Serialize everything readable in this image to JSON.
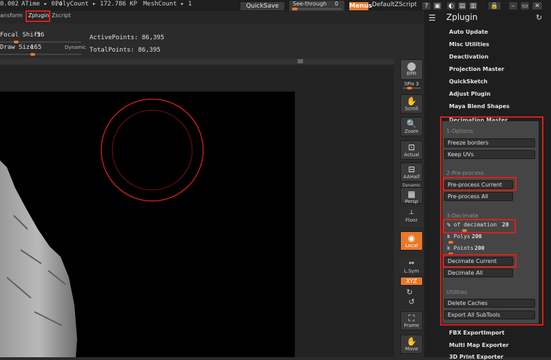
{
  "topbar": {
    "stats": [
      "0.002",
      "ATime ▸ 0.4",
      "PolyCount ▸ 172.786 KP",
      "MeshCount ▸ 1"
    ],
    "quicksave": "QuickSave",
    "see_through_label": "See-through",
    "see_through_value": "0",
    "see_through_level": 0.0,
    "menus": "Menus",
    "default_zscript": "DefaultZScript",
    "accent": "#e8792a"
  },
  "menubar": {
    "tabs": [
      "ansform",
      "Zplugin",
      "Zscript"
    ]
  },
  "params": {
    "focal_label": "Focal Shift",
    "focal_value": "-56",
    "draw_label": "Draw Size",
    "draw_value": "165",
    "dynamic": "Dynamic",
    "active_points": "ActivePoints: 86,395",
    "total_points": "TotalPoints: 86,395"
  },
  "shelf": {
    "bpr": "BPR",
    "spix": "SPix 3",
    "buttons": [
      "Scroll",
      "Zoom",
      "Actual",
      "AAHalf",
      "Persp",
      "Floor",
      "Local",
      "L.Sym",
      "XYZ",
      "Frame",
      "Move"
    ],
    "dynamic": "Dynamic"
  },
  "palette": {
    "title": "Zplugin",
    "items": [
      "Auto Update",
      "Misc Utilities",
      "Deactivation",
      "Projection Master",
      "QuickSketch",
      "Adjust Plugin",
      "Maya Blend Shapes"
    ],
    "decimation_master": "Decimation Master",
    "options_head": "1-Options",
    "freeze_borders": "Freeze borders",
    "keep_uvs": "Keep UVs",
    "preprocess_head": "2-Pre-process",
    "preprocess_current": "Pre-process Current",
    "preprocess_all": "Pre-process All",
    "decimate_head": "3-Decimate",
    "percent_label": "% of decimation",
    "percent_value": "20",
    "kpolys_label": "k Polys",
    "kpolys_value": "200",
    "kpoints_label": "k Points",
    "kpoints_value": "200",
    "decimate_current": "Decimate Current",
    "decimate_all": "Decimate All",
    "utilities_head": "Utilities",
    "delete_caches": "Delete Caches",
    "export_subtools": "Export All SubTools",
    "after_items": [
      "FBX ExportImport",
      "Multi Map Exporter",
      "3D Print Exporter"
    ]
  }
}
